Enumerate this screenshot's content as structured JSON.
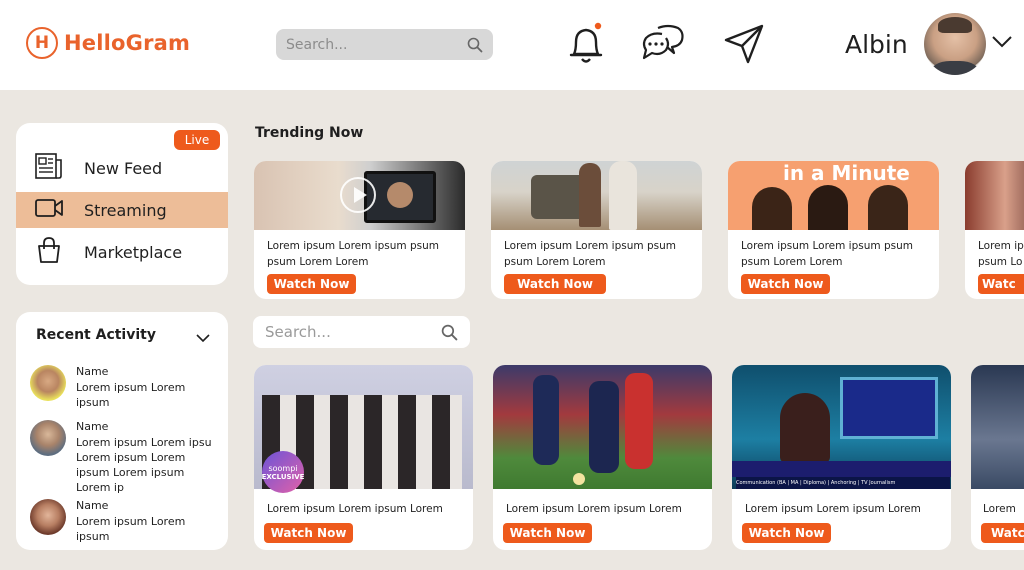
{
  "app": {
    "logo_mark": "H",
    "name": "HelloGram"
  },
  "header": {
    "search_placeholder": "Search...",
    "user_name": "Albin",
    "icons": [
      "bell-icon",
      "chat-icon",
      "send-icon",
      "chevron-down-icon"
    ]
  },
  "sidebar": {
    "live_label": "Live",
    "items": [
      {
        "label": "New Feed",
        "icon": "newspaper-icon",
        "active": false
      },
      {
        "label": "Streaming",
        "icon": "video-camera-icon",
        "active": true
      },
      {
        "label": "Marketplace",
        "icon": "shopping-bag-icon",
        "active": false
      }
    ]
  },
  "recent_activity": {
    "title": "Recent Activity",
    "items": [
      {
        "name": "Name",
        "text": "Lorem ipsum Lorem ipsum"
      },
      {
        "name": "Name",
        "text": "Lorem ipsum Lorem ipsu Lorem ipsum Lorem ipsum Lorem ipsum Lorem ip"
      },
      {
        "name": "Name",
        "text": "Lorem ipsum Lorem ipsum"
      }
    ]
  },
  "trending": {
    "title": "Trending Now",
    "cards": [
      {
        "text": "Lorem ipsum Lorem ipsum psum psum Lorem Lorem",
        "button": "Watch Now"
      },
      {
        "text": "Lorem ipsum Lorem ipsum psum psum Lorem Lorem",
        "button": "Watch Now"
      },
      {
        "text": "Lorem ipsum Lorem ipsum psum psum Lorem Lorem",
        "button": "Watch Now",
        "overlay": "in a Minute"
      },
      {
        "text": "Lorem ip psum Lo",
        "button": "Watc"
      }
    ]
  },
  "content_search": {
    "placeholder": "Search..."
  },
  "videos": [
    {
      "text": "Lorem ipsum Lorem ipsum Lorem",
      "button": "Watch Now",
      "badge_line1": "soompi",
      "badge_line2": "EXCLUSIVE"
    },
    {
      "text": "Lorem ipsum Lorem ipsum Lorem",
      "button": "Watch Now"
    },
    {
      "text": "Lorem ipsum Lorem ipsum Lorem",
      "button": "Watch Now",
      "ticker": "Communication (BA | MA | Diploma) | Anchoring | TV Journalism"
    },
    {
      "text": "Lorem",
      "button": "Watc"
    }
  ],
  "colors": {
    "accent": "#ee5a1c",
    "logo": "#e9632c",
    "active_nav": "#edbd98",
    "background": "#ebe7e1"
  }
}
